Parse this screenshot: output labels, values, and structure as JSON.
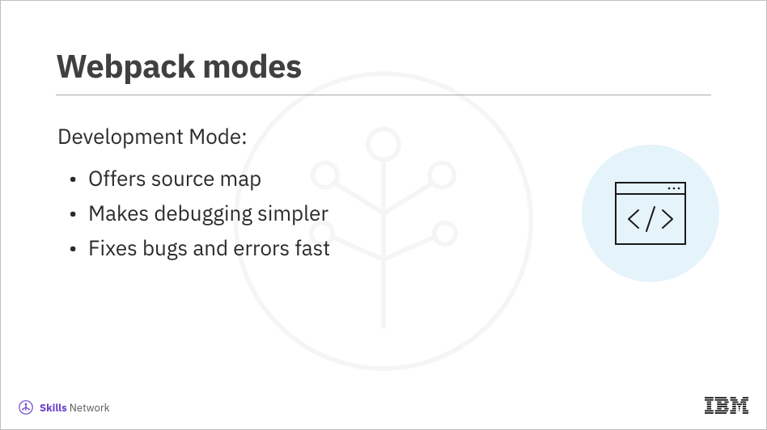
{
  "slide": {
    "title": "Webpack modes",
    "subtitle": "Development Mode:",
    "bullets": [
      "Offers source map",
      "Makes debugging simpler",
      "Fixes bugs and errors fast"
    ]
  },
  "footer": {
    "skills_bold": "Skills",
    "skills_regular": " Network",
    "ibm_label": "IBM"
  },
  "icons": {
    "illustration": "code-window-icon",
    "watermark": "network-tree-icon",
    "skills_badge": "skills-badge-icon",
    "ibm": "ibm-logo-icon"
  }
}
